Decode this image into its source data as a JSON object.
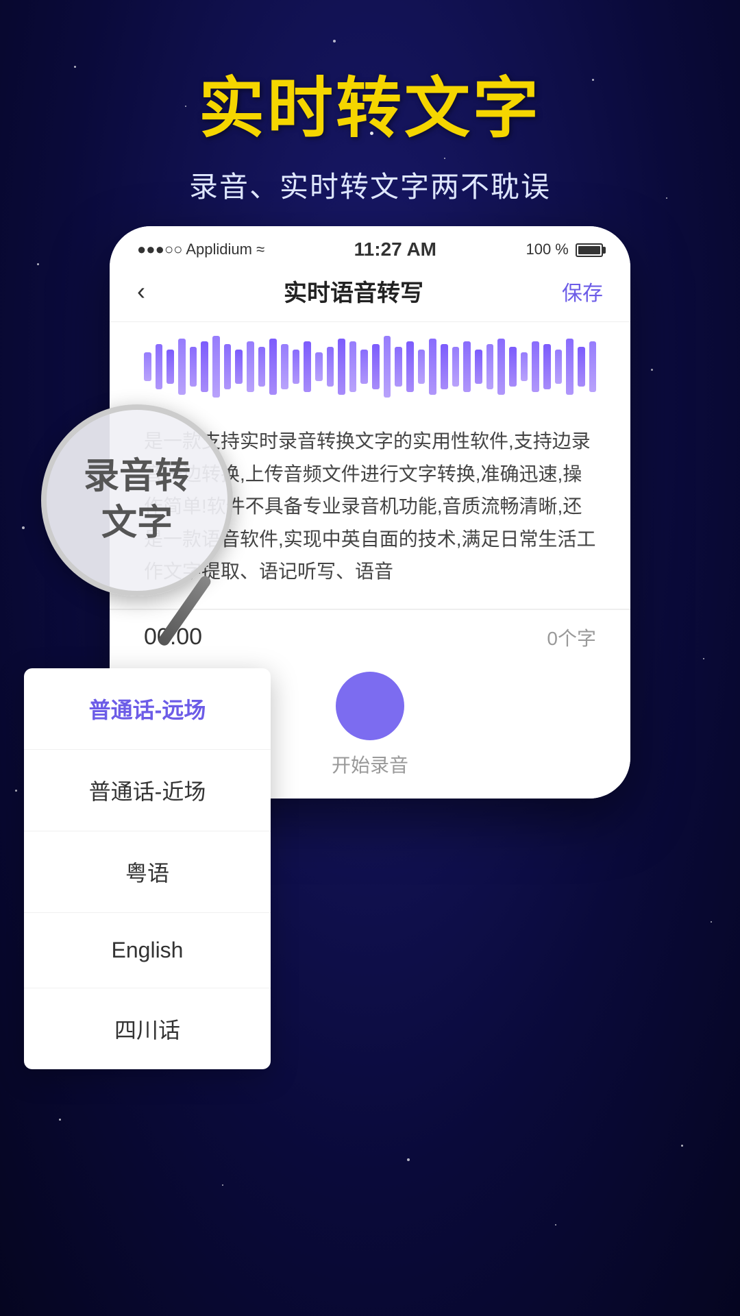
{
  "background": {
    "colors": {
      "primary": "#0a0a3a",
      "gradient_mid": "#1a1a6e"
    }
  },
  "header": {
    "main_title": "实时转文字",
    "subtitle": "录音、实时转文字两不耽误"
  },
  "status_bar": {
    "carrier": "●●●○○ Applidium",
    "wifi_icon": "wifi",
    "time": "11:27 AM",
    "battery_percent": "100 %",
    "battery_icon": "battery"
  },
  "nav": {
    "back_icon": "‹",
    "title": "实时语音转写",
    "save_label": "保存"
  },
  "waveform": {
    "bars": [
      4,
      7,
      5,
      9,
      6,
      8,
      10,
      7,
      5,
      8,
      6,
      9,
      7,
      5,
      8,
      4,
      6,
      9,
      8,
      5,
      7,
      10,
      6,
      8,
      5,
      9,
      7,
      6,
      8,
      5,
      7,
      9,
      6,
      4,
      8,
      7,
      5,
      9,
      6,
      8
    ]
  },
  "transcription_text": "是一款支持实时录音转换文字的实用性软件,支持边录音一边转换,上传音频文件进行文字转换,准确迅速,操作简单!软件不具备专业录音机功能,音质流畅清晰,还是一款语音软件,实现中英自面的技术,满足日常生活工作文字提取、语记听写、语音",
  "bottom_controls": {
    "timer": "00:00",
    "word_count": "0个字",
    "record_hint": "开始录音"
  },
  "magnifier": {
    "text_line1": "录音转",
    "text_line2": "文字"
  },
  "dropdown": {
    "items": [
      {
        "label": "普通话-远场",
        "active": true
      },
      {
        "label": "普通话-近场",
        "active": false
      },
      {
        "label": "粤语",
        "active": false
      },
      {
        "label": "English",
        "active": false
      },
      {
        "label": "四川话",
        "active": false
      }
    ]
  }
}
